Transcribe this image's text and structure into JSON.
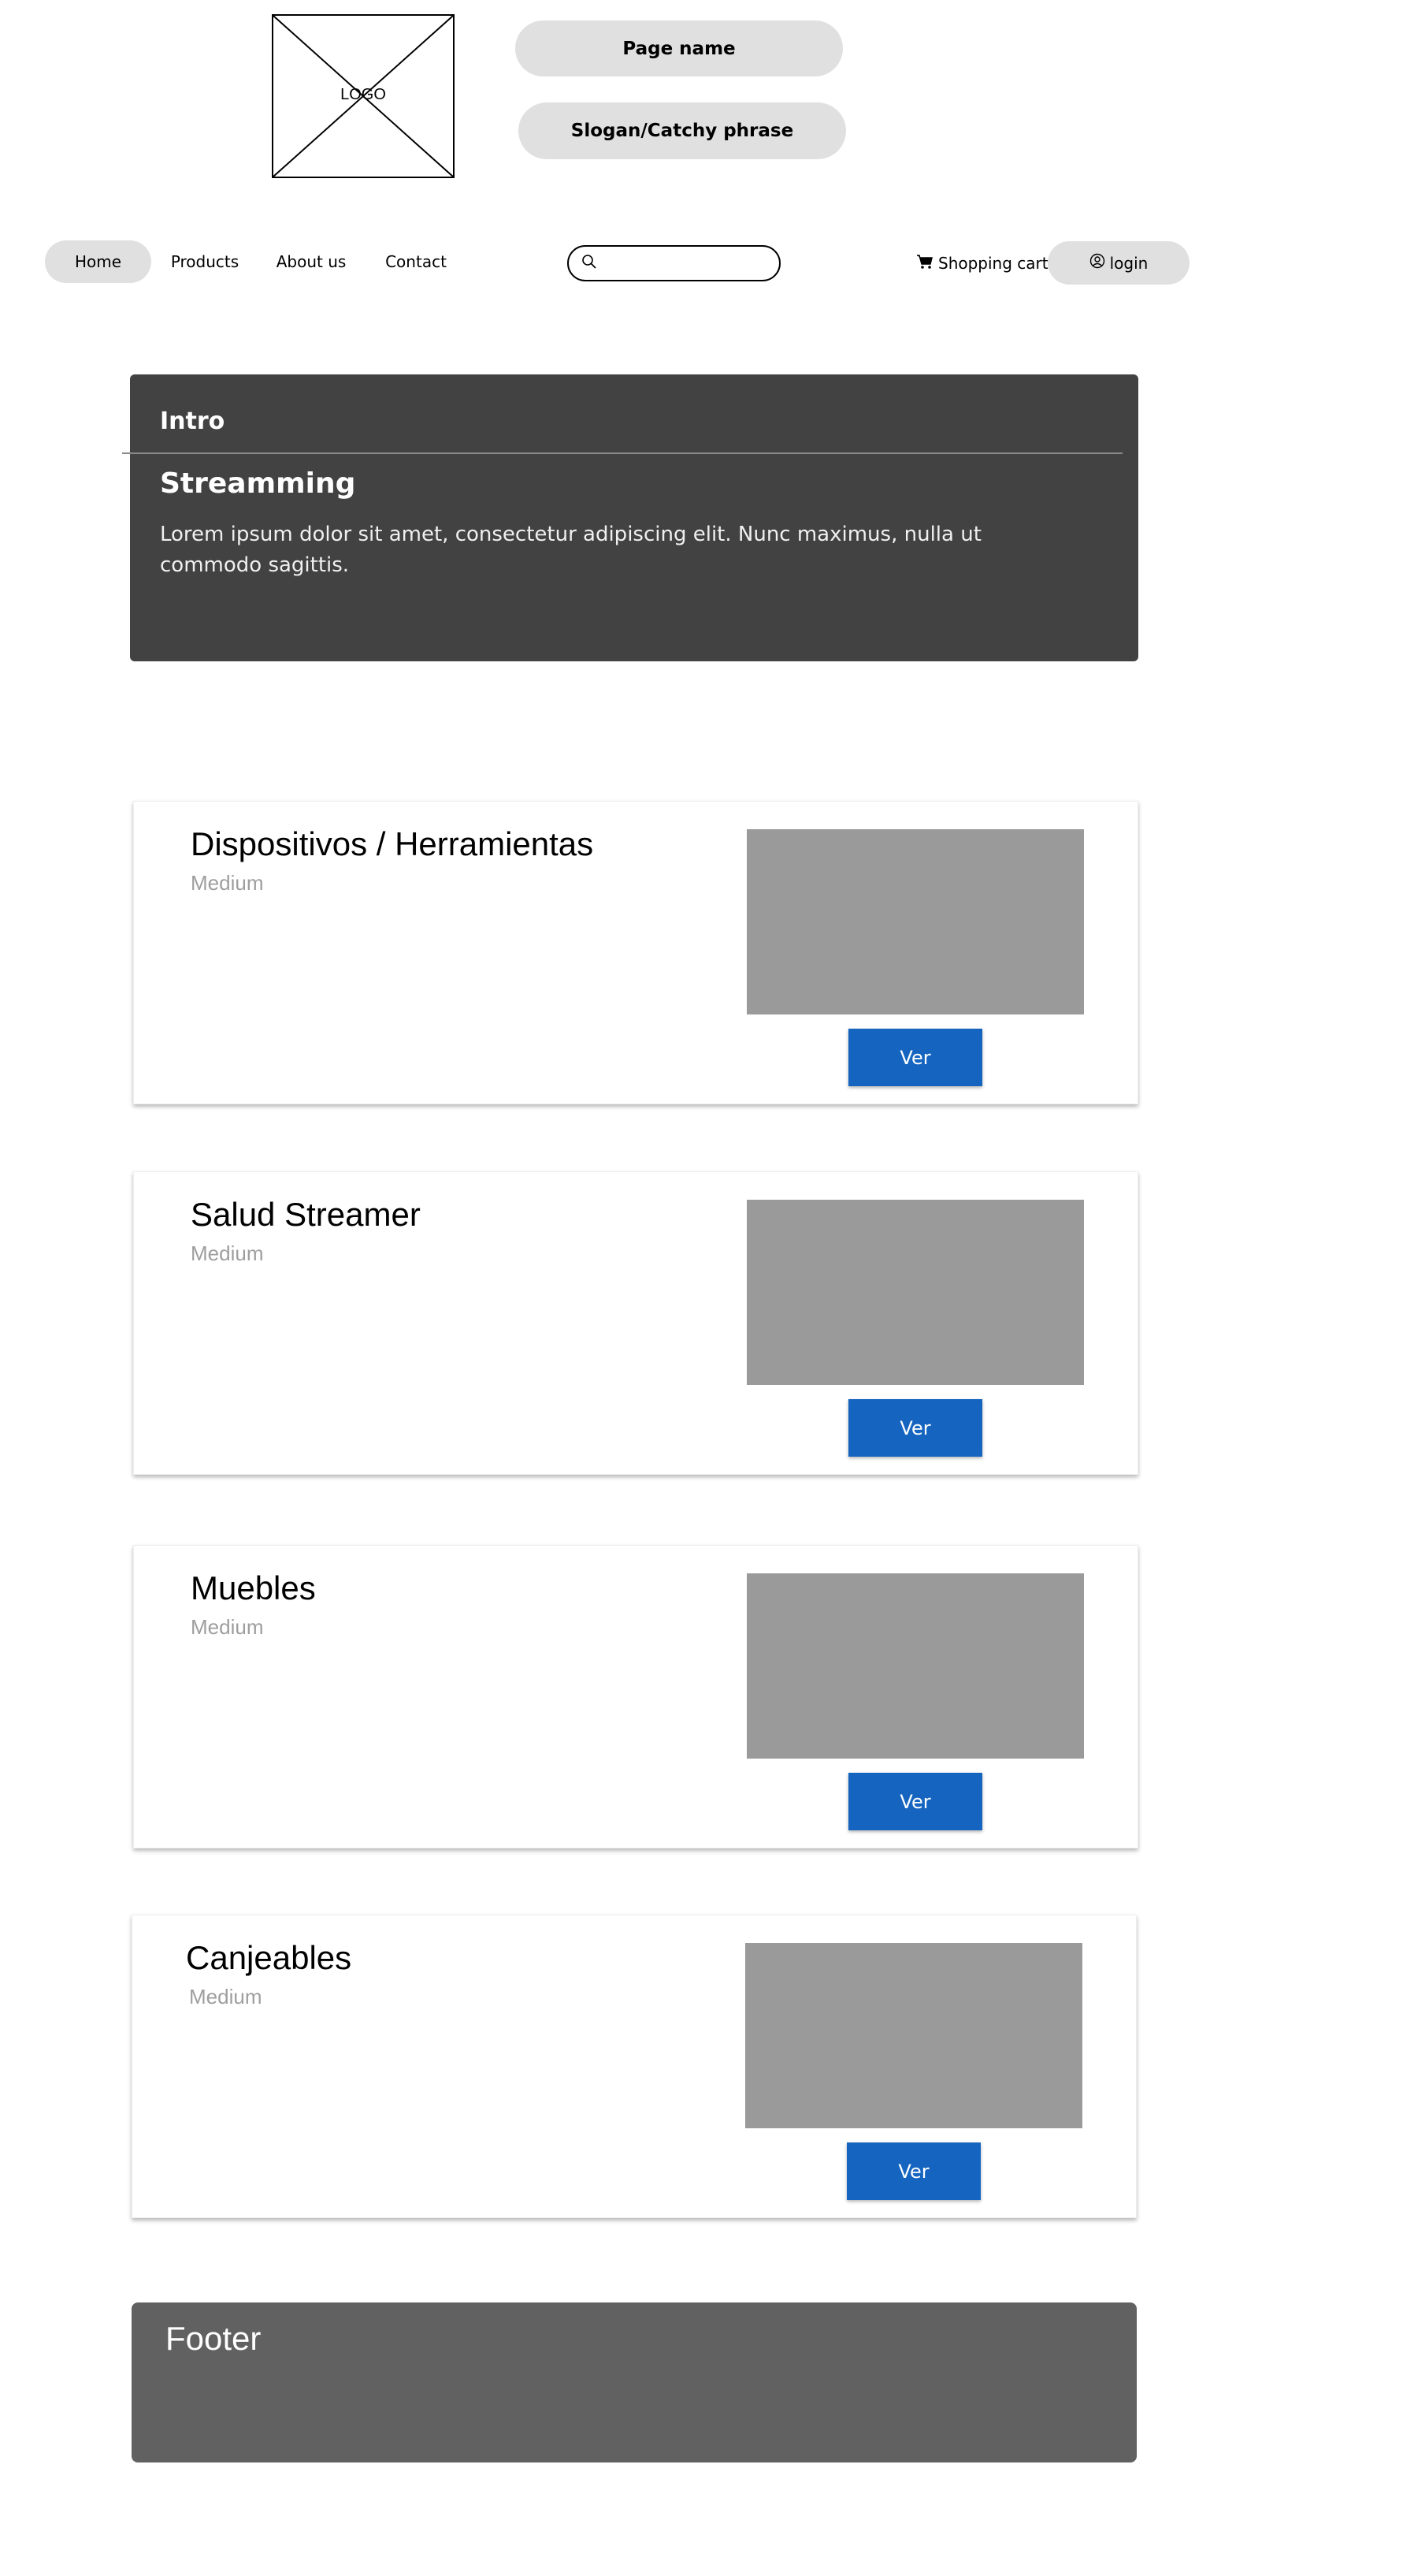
{
  "header": {
    "logo_text": "LOGO",
    "page_name": "Page name",
    "slogan": "Slogan/Catchy phrase"
  },
  "nav": {
    "items": [
      {
        "label": "Home",
        "active": true
      },
      {
        "label": "Products"
      },
      {
        "label": "About us"
      },
      {
        "label": "Contact"
      }
    ],
    "search": {
      "value": "",
      "placeholder": ""
    },
    "cart_label": "Shopping cart",
    "login_label": "login"
  },
  "intro": {
    "label": "Intro",
    "title": "Streamming",
    "body": "Lorem ipsum dolor sit amet, consectetur adipiscing elit. Nunc maximus, nulla ut commodo sagittis."
  },
  "cards": [
    {
      "title": "Dispositivos / Herramientas",
      "subtitle": "Medium",
      "button": "Ver"
    },
    {
      "title": "Salud Streamer",
      "subtitle": "Medium",
      "button": "Ver"
    },
    {
      "title": "Muebles",
      "subtitle": "Medium",
      "button": "Ver"
    },
    {
      "title": "Canjeables",
      "subtitle": "Medium",
      "button": "Ver"
    }
  ],
  "footer": {
    "label": "Footer"
  },
  "colors": {
    "pill_bg": "#e0e0e0",
    "intro_bg": "#424242",
    "image_placeholder": "#9a9a9a",
    "button_primary": "#1565c0",
    "footer_bg": "#616161",
    "subtitle_text": "#9e9e9e"
  },
  "icons": {
    "search": "search-icon",
    "cart": "cart-icon",
    "user": "user-icon"
  }
}
